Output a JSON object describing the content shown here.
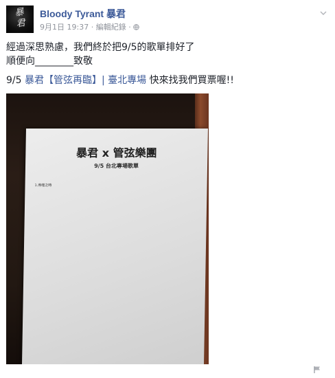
{
  "post": {
    "author": "Bloody Tyrant 暴君",
    "timestamp": "9月1日 19:37",
    "edit_history": "編輯紀錄",
    "dot": "·",
    "line1": "經過深思熟慮，我們終於把9/5的歌單排好了",
    "line2": "順便向________致敬",
    "line3_prefix": "9/5 ",
    "line3_tag": "暴君【管弦再臨】| 臺北專場",
    "line3_suffix": " 快來找我們買票喔!!"
  },
  "photo": {
    "paper_title": "暴君 x 管弦樂團",
    "paper_subtitle": "9/5 台北專場歌單",
    "paper_item": "1.燕噬之時"
  },
  "icons": {
    "avatar": "band-logo",
    "privacy": "globe-icon",
    "menu": "chevron-down-icon",
    "report": "flag-icon"
  },
  "colors": {
    "link": "#3b5998",
    "meta": "#90949c",
    "text": "#1d2129"
  }
}
